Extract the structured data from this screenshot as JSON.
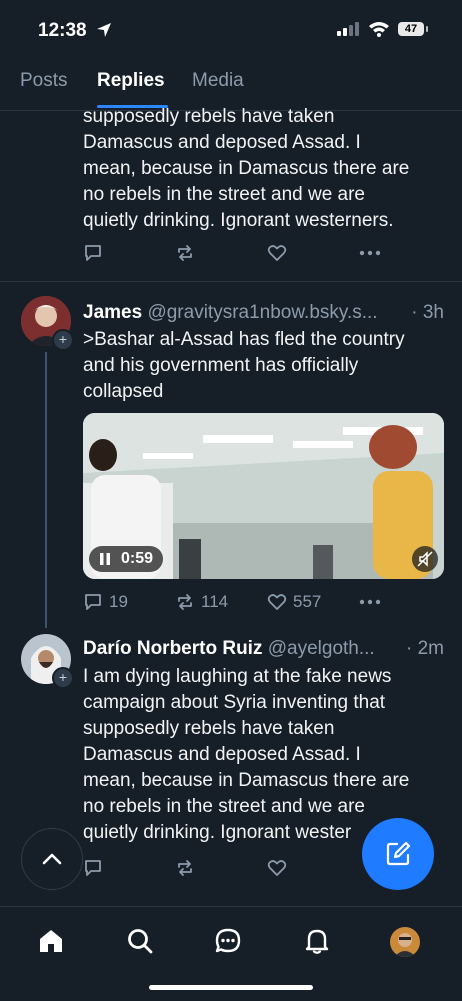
{
  "status": {
    "time": "12:38",
    "battery": "47"
  },
  "tabs": [
    {
      "label": "Posts"
    },
    {
      "label": "Replies"
    },
    {
      "label": "Media"
    }
  ],
  "top_post": {
    "text_lines": [
      "supposedly rebels have taken",
      "Damascus and deposed Assad. I",
      "mean, because in Damascus there are",
      "no rebels in the street and we are",
      "quietly drinking. Ignorant westerners."
    ]
  },
  "post2": {
    "author": "James",
    "handle": "@gravitysra1nbow.bsky.s...",
    "time": "· 3h",
    "text_lines": [
      ">Bashar al-Assad has fled the country",
      "and his government has officially",
      "collapsed"
    ],
    "video_duration": "0:59",
    "replies": "19",
    "reposts": "114",
    "likes": "557"
  },
  "post3": {
    "author": "Darío Norberto Ruiz",
    "handle": "@ayelgoth...",
    "time": "· 2m",
    "text_lines": [
      "I am dying laughing at the fake news",
      "campaign about Syria inventing that",
      "supposedly rebels have taken",
      "Damascus and deposed Assad. I",
      "mean, because in Damascus there are",
      "no rebels in the street and we are",
      "quietly drinking. Ignorant wester"
    ]
  },
  "icons": {
    "reply": "speech-bubble-icon",
    "repost": "repost-icon",
    "like": "heart-icon",
    "more": "ellipsis-icon",
    "nav": [
      "home-icon",
      "search-icon",
      "chat-icon",
      "bell-icon",
      "profile-avatar"
    ]
  },
  "colors": {
    "background": "#161e27",
    "accent": "#1f7bff",
    "muted": "#8c9bab"
  }
}
